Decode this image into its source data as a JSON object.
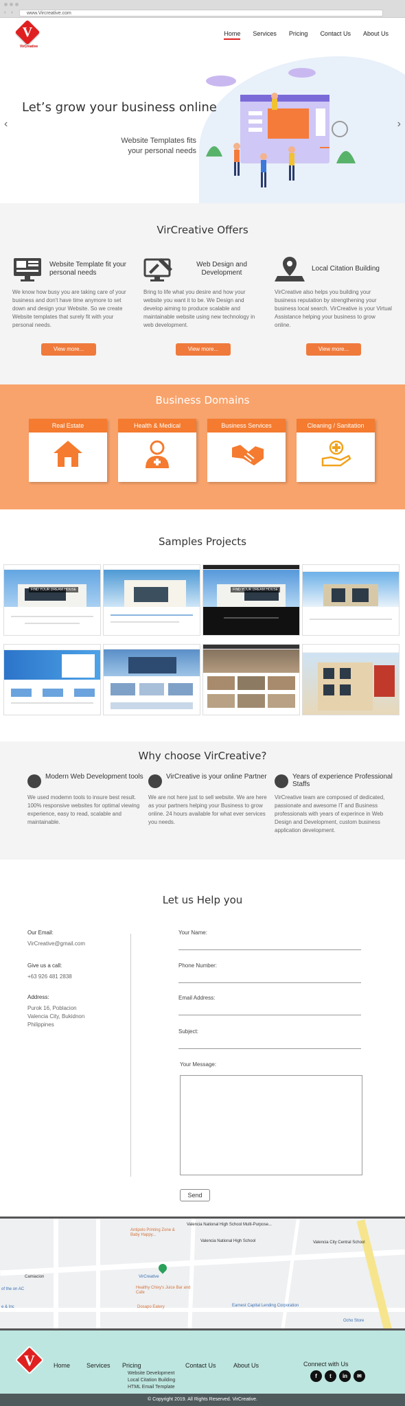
{
  "browser": {
    "url": "www.Vircreative.com"
  },
  "brand": {
    "logo_letter": "V",
    "logo_text": "VirCreative"
  },
  "nav": {
    "items": [
      "Home",
      "Services",
      "Pricing",
      "Contact Us",
      "About Us"
    ],
    "active": "Home"
  },
  "hero": {
    "title": "Let’s grow your business online",
    "subtitle_line1": "Website Templates fits",
    "subtitle_line2": "your personal needs",
    "prev": "‹",
    "next": "›"
  },
  "offers": {
    "title": "VirCreative Offers",
    "items": [
      {
        "icon": "monitor-template-icon",
        "title": "Website Template fit your personal needs",
        "desc": "We know how busy you are taking care of your business and don't have time anymore to set down and design your Website. So we create Website templates that surely fit with your personal needs.",
        "button": "View more..."
      },
      {
        "icon": "design-tools-icon",
        "title": "Web Design and Development",
        "desc": "Bring to life what you desire and how your website you want it to be. We Design and develop aiming to produce scalable and maintainable website using new technology in web development.",
        "button": "View more..."
      },
      {
        "icon": "map-pin-icon",
        "title": "Local Citation Building",
        "desc": "VirCreative also helps you building your business reputation by strengthening your business local search. VirCreative is your Virtual Assistance helping your business to grow online.",
        "button": "View more..."
      }
    ]
  },
  "domains": {
    "title": "Business Domains",
    "items": [
      {
        "label": "Real Estate",
        "icon": "house-icon"
      },
      {
        "label": "Health & Medical",
        "icon": "doctor-icon"
      },
      {
        "label": "Business Services",
        "icon": "handshake-icon"
      },
      {
        "label": "Cleaning / Sanitation",
        "icon": "cleaning-hand-icon"
      }
    ]
  },
  "samples": {
    "title": "Samples Projects",
    "thumb_label": "FIND YOUR DREAM HOUSE"
  },
  "why": {
    "title": "Why choose VirCreative?",
    "items": [
      {
        "title": "Modern Web Development tools",
        "desc": "We used modemn tools to insure best result. 100% responsive websites for optimal viewing experience, easy to read, scalable and maintainable."
      },
      {
        "title": "VirCreative is your online Partner",
        "desc": "We are not here just to sell website. We are here as your partners helping your Business to grow online. 24 hours available for what ever services you needs."
      },
      {
        "title": "Years of experience Professional Staffs",
        "desc": "VirCreative team are composed of dedicated, passionate and awesome IT and Business professionals with years of experince in Web Design and Development, custom business application development."
      }
    ]
  },
  "contact": {
    "title": "Let us Help you",
    "email_label": "Our Email:",
    "email": "VirCreative@gmail.com",
    "call_label": "Give us a call:",
    "phone": "+63 926 481 2838",
    "address_label": "Address:",
    "address_line1": "Purok 16, Poblacion",
    "address_line2": "Valencia City, Bukidnon",
    "address_line3": "Philippines",
    "fields": [
      "Your Name:",
      "Phone Number:",
      "Email Address:",
      "Subject:"
    ],
    "message_label": "Your Message:",
    "send": "Send"
  },
  "map": {
    "labels": [
      "Valencia National High School Multi-Purpose...",
      "Valencia National High School",
      "Valencia City Central School",
      "Antipolo Printing Zone & Baby Happy...",
      "VirCreative",
      "Healthy Chixy's Juice Bar and Cafe",
      "Dosapo Eatery",
      "Earnest Capital Lending Corporation",
      "Ocho Store",
      "Camiacion",
      "of the on AC",
      "e & Inc"
    ]
  },
  "footer": {
    "nav": [
      "Home",
      "Services",
      "Pricing",
      "Contact Us",
      "About Us"
    ],
    "pricing_sub": [
      "Website Development",
      "Local Citation Building",
      "HTML Email Template"
    ],
    "connect": "Connect with Us",
    "social": [
      "f",
      "t",
      "in",
      "✉"
    ],
    "copyright": "© Copyright 2019. All Rights Reserved. VirCreative."
  }
}
